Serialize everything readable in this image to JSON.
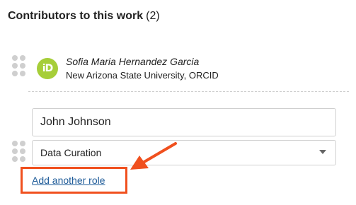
{
  "section": {
    "title": "Contributors to this work",
    "count": "(2)"
  },
  "contributors": [
    {
      "name": "Sofia Maria Hernandez Garcia",
      "affiliation": "New Arizona State University, ORCID",
      "badge": "iD"
    }
  ],
  "new_contributor": {
    "name_value": "John Johnson",
    "role_selected": "Data Curation",
    "add_role_label": "Add another role"
  },
  "annotation": {
    "color": "#f0501e"
  },
  "icons": {
    "drag": "drag-handle-icon",
    "orcid": "orcid-icon",
    "caret": "chevron-down-icon",
    "arrow": "arrow-icon"
  },
  "colors": {
    "link": "#1f5c99",
    "orcid_green": "#a6ce39",
    "highlight": "#f0501e"
  }
}
